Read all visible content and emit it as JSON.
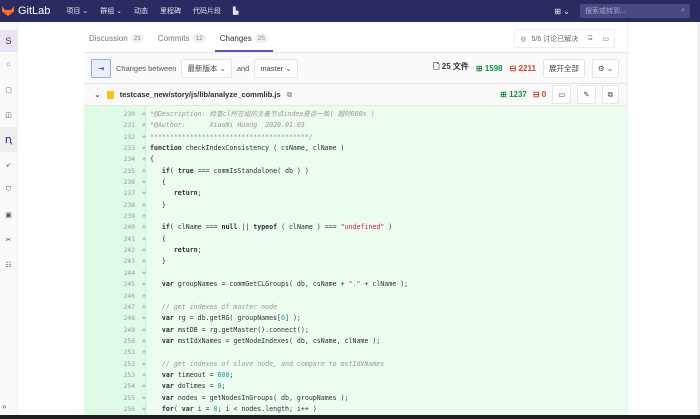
{
  "topbar": {
    "brand": "GitLab",
    "nav": [
      "项目 ⌄",
      "群组 ⌄",
      "动态",
      "里程碑",
      "代码片段",
      "▙"
    ],
    "new_icon": "plus-square-icon",
    "search_placeholder": "搜索或转到..."
  },
  "sidebar": {
    "project_letter": "S",
    "icons": [
      "home-icon",
      "repository-icon",
      "issues-icon",
      "merge-request-icon",
      "rocket-icon",
      "ci-icon",
      "wiki-icon",
      "snippets-icon",
      "members-icon"
    ],
    "expand": "»"
  },
  "tabs": [
    {
      "label": "Discussion",
      "count": "21"
    },
    {
      "label": "Commits",
      "count": "12"
    },
    {
      "label": "Changes",
      "count": "25"
    }
  ],
  "resolved": "5/6 讨论已解决",
  "toolbar": {
    "changes_between": "Changes between",
    "version": "最新版本 ⌄",
    "and": "and",
    "target": "master ⌄",
    "files": "25 文件",
    "additions": "1598",
    "deletions": "2211",
    "expand_all": "展开全部",
    "settings": "⚙ ⌄"
  },
  "file": {
    "path": "testcase_new/story/js/lib/analyze_commlib.js",
    "additions": "1237",
    "deletions": "0"
  },
  "diff_lines": [
    {
      "n": "230",
      "h": "<span class=\"cm\">*@Description: 检查cl所在组的主备节点index是否一致( 超时600s )</span>"
    },
    {
      "n": "231",
      "h": "<span class=\"cm\">*@Author:      XiaoNi Huang  2020.01.03</span>"
    },
    {
      "n": "232",
      "h": "<span class=\"cm\">****************************************/</span>"
    },
    {
      "n": "233",
      "h": "<span class=\"kw\">function</span> checkIndexConsistency ( csName, clName )"
    },
    {
      "n": "234",
      "h": "{"
    },
    {
      "n": "235",
      "h": "   <span class=\"kw\">if</span>( <span class=\"kw\">true</span> === commIsStandalone( db ) )"
    },
    {
      "n": "236",
      "h": "   {"
    },
    {
      "n": "237",
      "h": "      <span class=\"kw\">return</span>;"
    },
    {
      "n": "238",
      "h": "   }"
    },
    {
      "n": "239",
      "h": ""
    },
    {
      "n": "240",
      "h": "   <span class=\"kw\">if</span>( clName === <span class=\"kw\">null</span> || <span class=\"kw\">typeof</span> ( clName ) === <span class=\"st\">\"undefined\"</span> )"
    },
    {
      "n": "241",
      "h": "   {"
    },
    {
      "n": "242",
      "h": "      <span class=\"kw\">return</span>;"
    },
    {
      "n": "243",
      "h": "   }"
    },
    {
      "n": "244",
      "h": ""
    },
    {
      "n": "245",
      "h": "   <span class=\"kw\">var</span> groupNames = commGetCLGroups( db, csName + <span class=\"st\">\".\"</span> + clName );"
    },
    {
      "n": "246",
      "h": ""
    },
    {
      "n": "247",
      "h": "   <span class=\"cm\">// get indexes of master node</span>"
    },
    {
      "n": "248",
      "h": "   <span class=\"kw\">var</span> rg = db.getRG( groupNames[<span class=\"nm\">0</span>] );"
    },
    {
      "n": "249",
      "h": "   <span class=\"kw\">var</span> mstDB = rg.getMaster().connect();"
    },
    {
      "n": "250",
      "h": "   <span class=\"kw\">var</span> mstIdxNames = getNodeIndexes( db, csName, clName );"
    },
    {
      "n": "251",
      "h": ""
    },
    {
      "n": "252",
      "h": "   <span class=\"cm\">// get indexes of slave node, and compare to mstIdxNames</span>"
    },
    {
      "n": "253",
      "h": "   <span class=\"kw\">var</span> timeout = <span class=\"nm\">600</span>;"
    },
    {
      "n": "254",
      "h": "   <span class=\"kw\">var</span> doTimes = <span class=\"nm\">0</span>;"
    },
    {
      "n": "255",
      "h": "   <span class=\"kw\">var</span> nodes = getNodesInGroups( db, groupNames );"
    },
    {
      "n": "256",
      "h": "   <span class=\"kw\">for</span>( <span class=\"kw\">var</span> i = <span class=\"nm\">0</span>; i &lt; nodes.length; i++ )"
    }
  ]
}
